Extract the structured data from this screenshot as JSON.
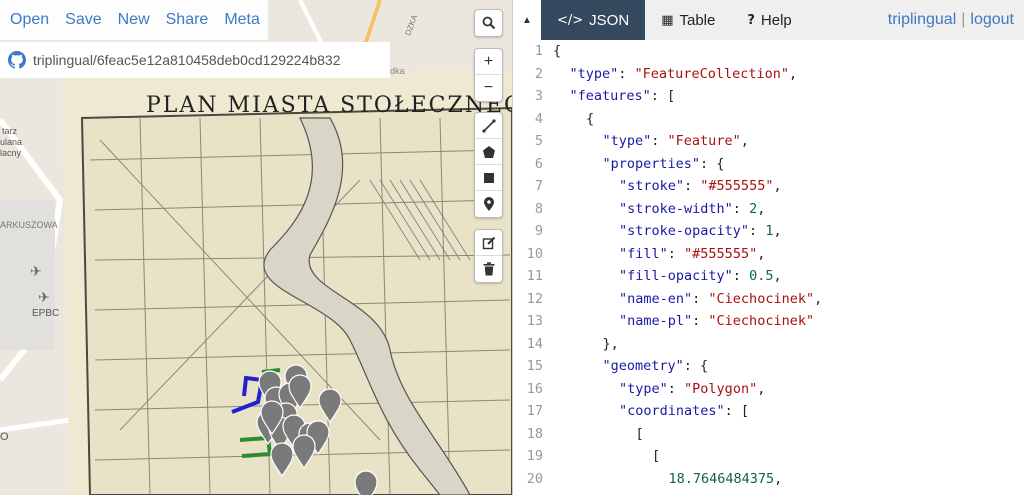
{
  "menu": [
    "Open",
    "Save",
    "New",
    "Share",
    "Meta"
  ],
  "gist_label": "triplingual/6feac5e12a810458deb0cd129224b832",
  "map": {
    "title": "PLAN MIASTA STOŁECZNEGO W",
    "labels": [
      "EPBC",
      "ARKUSZOWA",
      "tarz",
      "ulana",
      "lacny",
      "O",
      "DZKA",
      "Łódka"
    ],
    "marker_color": "#7a7a7a",
    "line_colors": [
      "#2222cc",
      "#2e8b2e"
    ]
  },
  "tools": {
    "search": "search-icon",
    "zoom_in": "+",
    "zoom_out": "−",
    "draw": [
      "draw-line-icon",
      "draw-polygon-icon",
      "draw-rectangle-icon",
      "draw-marker-icon"
    ],
    "edit": [
      "edit-icon",
      "delete-icon"
    ]
  },
  "collapse_glyph": "▲",
  "tabs": [
    {
      "icon": "</>",
      "label": "JSON",
      "active": true
    },
    {
      "icon": "▦",
      "label": "Table",
      "active": false
    },
    {
      "icon": "?",
      "label": "Help",
      "active": false
    }
  ],
  "auth": {
    "user": "triplingual",
    "separator": "|",
    "logout": "logout"
  },
  "code_lines": [
    {
      "n": "1",
      "indent": 0,
      "tokens": [
        [
          "p",
          "{"
        ]
      ]
    },
    {
      "n": "2",
      "indent": 1,
      "tokens": [
        [
          "k",
          "\"type\""
        ],
        [
          "p",
          ": "
        ],
        [
          "s",
          "\"FeatureCollection\""
        ],
        [
          "p",
          ","
        ]
      ]
    },
    {
      "n": "3",
      "indent": 1,
      "tokens": [
        [
          "k",
          "\"features\""
        ],
        [
          "p",
          ": ["
        ]
      ]
    },
    {
      "n": "4",
      "indent": 2,
      "tokens": [
        [
          "p",
          "{"
        ]
      ]
    },
    {
      "n": "5",
      "indent": 3,
      "tokens": [
        [
          "k",
          "\"type\""
        ],
        [
          "p",
          ": "
        ],
        [
          "s",
          "\"Feature\""
        ],
        [
          "p",
          ","
        ]
      ]
    },
    {
      "n": "6",
      "indent": 3,
      "tokens": [
        [
          "k",
          "\"properties\""
        ],
        [
          "p",
          ": {"
        ]
      ]
    },
    {
      "n": "7",
      "indent": 4,
      "tokens": [
        [
          "k",
          "\"stroke\""
        ],
        [
          "p",
          ": "
        ],
        [
          "s",
          "\"#555555\""
        ],
        [
          "p",
          ","
        ]
      ]
    },
    {
      "n": "8",
      "indent": 4,
      "tokens": [
        [
          "k",
          "\"stroke-width\""
        ],
        [
          "p",
          ": "
        ],
        [
          "n",
          "2"
        ],
        [
          "p",
          ","
        ]
      ]
    },
    {
      "n": "9",
      "indent": 4,
      "tokens": [
        [
          "k",
          "\"stroke-opacity\""
        ],
        [
          "p",
          ": "
        ],
        [
          "n",
          "1"
        ],
        [
          "p",
          ","
        ]
      ]
    },
    {
      "n": "10",
      "indent": 4,
      "tokens": [
        [
          "k",
          "\"fill\""
        ],
        [
          "p",
          ": "
        ],
        [
          "s",
          "\"#555555\""
        ],
        [
          "p",
          ","
        ]
      ]
    },
    {
      "n": "11",
      "indent": 4,
      "tokens": [
        [
          "k",
          "\"fill-opacity\""
        ],
        [
          "p",
          ": "
        ],
        [
          "n",
          "0.5"
        ],
        [
          "p",
          ","
        ]
      ]
    },
    {
      "n": "12",
      "indent": 4,
      "tokens": [
        [
          "k",
          "\"name-en\""
        ],
        [
          "p",
          ": "
        ],
        [
          "s",
          "\"Ciechocinek\""
        ],
        [
          "p",
          ","
        ]
      ]
    },
    {
      "n": "13",
      "indent": 4,
      "tokens": [
        [
          "k",
          "\"name-pl\""
        ],
        [
          "p",
          ": "
        ],
        [
          "s",
          "\"Ciechocinek\""
        ]
      ]
    },
    {
      "n": "14",
      "indent": 3,
      "tokens": [
        [
          "p",
          "},"
        ]
      ]
    },
    {
      "n": "15",
      "indent": 3,
      "tokens": [
        [
          "k",
          "\"geometry\""
        ],
        [
          "p",
          ": {"
        ]
      ]
    },
    {
      "n": "16",
      "indent": 4,
      "tokens": [
        [
          "k",
          "\"type\""
        ],
        [
          "p",
          ": "
        ],
        [
          "s",
          "\"Polygon\""
        ],
        [
          "p",
          ","
        ]
      ]
    },
    {
      "n": "17",
      "indent": 4,
      "tokens": [
        [
          "k",
          "\"coordinates\""
        ],
        [
          "p",
          ": ["
        ]
      ]
    },
    {
      "n": "18",
      "indent": 5,
      "tokens": [
        [
          "p",
          "["
        ]
      ]
    },
    {
      "n": "19",
      "indent": 6,
      "tokens": [
        [
          "p",
          "["
        ]
      ]
    },
    {
      "n": "20",
      "indent": 7,
      "tokens": [
        [
          "n",
          "18.7646484375"
        ],
        [
          "p",
          ","
        ]
      ]
    }
  ]
}
